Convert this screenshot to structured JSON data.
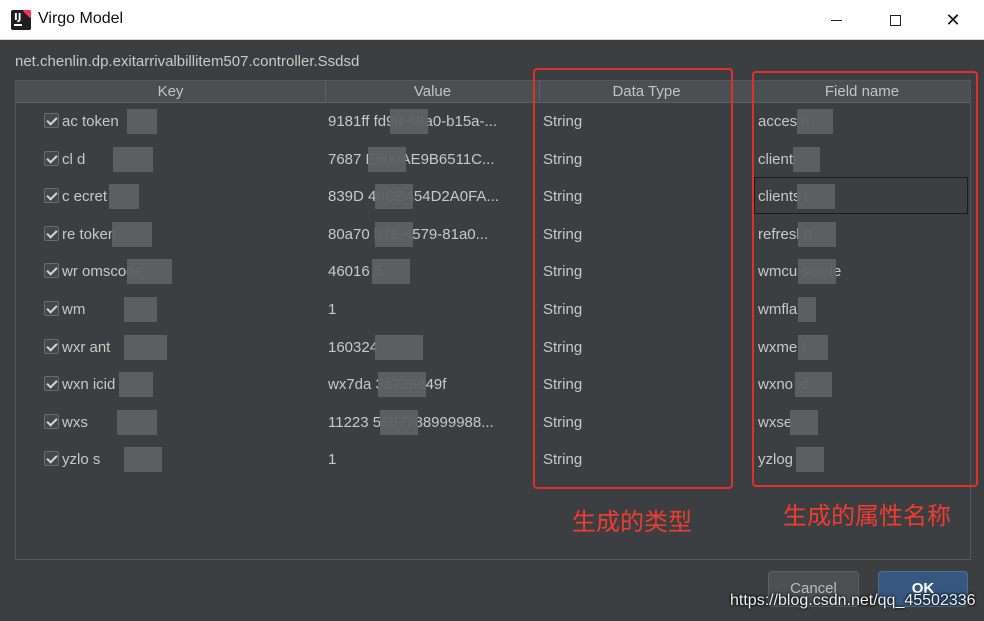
{
  "window": {
    "title": "Virgo Model",
    "icon": "intellij-idea-icon",
    "controls": [
      "minimize-icon",
      "maximize-icon",
      "close-icon"
    ]
  },
  "class_path": "net.chenlin.dp.exitarrivalbillitem507.controller.Ssdsd",
  "table": {
    "headers": [
      "Key",
      "Value",
      "Data Type",
      "Field name"
    ],
    "rows": [
      {
        "checked": true,
        "key": "ac token",
        "value": "9181ff fd98-48a0-b15a-...",
        "type": "String",
        "field": "acces n"
      },
      {
        "checked": true,
        "key": "cl d",
        "value": "7687 E600AE9B6511C...",
        "type": "String",
        "field": "clienti"
      },
      {
        "checked": true,
        "key": "c ecret",
        "value": "839D 40CE454D2A0FA...",
        "type": "String",
        "field": "clients t"
      },
      {
        "checked": true,
        "key": "re token",
        "value": "80a70 b76-4579-81a0...",
        "type": "String",
        "field": "refresl n"
      },
      {
        "checked": true,
        "key": "wr omscode",
        "value": "46016 5",
        "type": "String",
        "field": "wmcu scode"
      },
      {
        "checked": true,
        "key": "wm",
        "value": "1",
        "type": "String",
        "field": "wmfla"
      },
      {
        "checked": true,
        "key": "wxr ant",
        "value": "160324",
        "type": "String",
        "field": "wxme t"
      },
      {
        "checked": true,
        "key": "wxn icid",
        "value": "wx7da 3a725d49f",
        "type": "String",
        "field": "wxno id"
      },
      {
        "checked": true,
        "key": "wxs",
        "value": "11223 5667788999988...",
        "type": "String",
        "field": "wxse"
      },
      {
        "checked": true,
        "key": "yzlo s",
        "value": "1",
        "type": "String",
        "field": "yzlog"
      }
    ]
  },
  "annotations": {
    "type_label": "生成的类型",
    "field_label": "生成的属性名称",
    "color": "#e0302a"
  },
  "buttons": {
    "cancel": "Cancel",
    "ok": "OK"
  },
  "watermark": "https://blog.csdn.net/qq_45502336",
  "colors": {
    "background": "#3c3f41",
    "header": "#4b4f52",
    "ok": "#365880"
  }
}
